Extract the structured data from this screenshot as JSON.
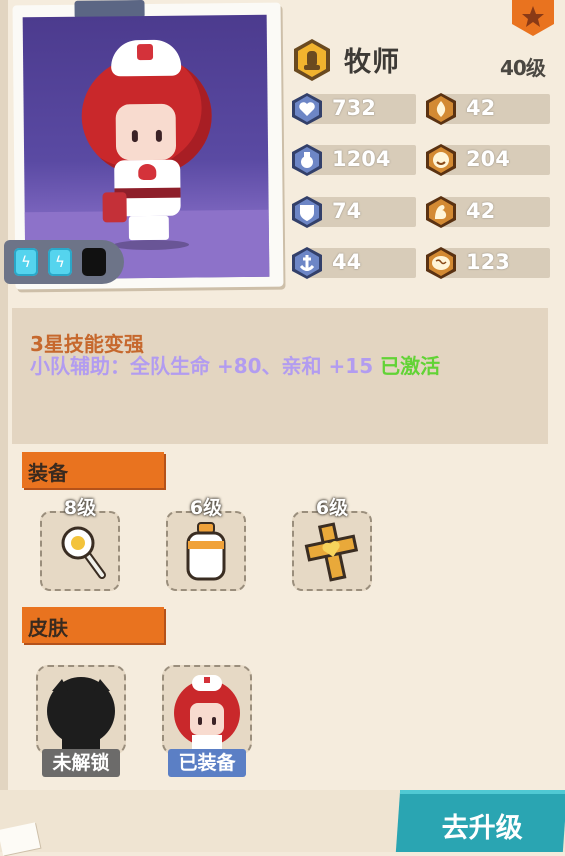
{
  "hero": {
    "class_name": "牧师",
    "level": "40级",
    "rank_color": "#e9731f",
    "skill_gems": [
      {
        "state": "active",
        "icon": "lightning-icon"
      },
      {
        "state": "active",
        "icon": "lightning-icon"
      },
      {
        "state": "locked",
        "icon": "empty-gem-icon"
      }
    ]
  },
  "stats": [
    {
      "icon": "heart-icon",
      "value": "732",
      "color": "#5e76b8"
    },
    {
      "icon": "fire-icon",
      "value": "42",
      "color": "#c97b2c"
    },
    {
      "icon": "potion-icon",
      "value": "1204",
      "color": "#5e76b8"
    },
    {
      "icon": "smile-icon",
      "value": "204",
      "color": "#c97b2c"
    },
    {
      "icon": "shield-icon",
      "value": "74",
      "color": "#5e76b8"
    },
    {
      "icon": "muscle-icon",
      "value": "42",
      "color": "#c97b2c"
    },
    {
      "icon": "anchor-icon",
      "value": "44",
      "color": "#5e76b8"
    },
    {
      "icon": "brain-icon",
      "value": "123",
      "color": "#c97b2c"
    }
  ],
  "skill": {
    "title": "3星技能变强",
    "desc_main": "小队辅助：全队生命 +80、亲和 +15",
    "desc_status": "已激活"
  },
  "equipment": {
    "header": "装备",
    "items": [
      {
        "name": "scepter-icon",
        "level": "8级"
      },
      {
        "name": "milk-bottle-icon",
        "level": "6级"
      },
      {
        "name": "golden-cross-icon",
        "level": "6级"
      }
    ]
  },
  "skins": {
    "header": "皮肤",
    "items": [
      {
        "name": "locked-skin",
        "label": "未解锁"
      },
      {
        "name": "nurse-skin",
        "label": "已装备"
      }
    ]
  },
  "actions": {
    "upgrade_label": "去升级"
  }
}
